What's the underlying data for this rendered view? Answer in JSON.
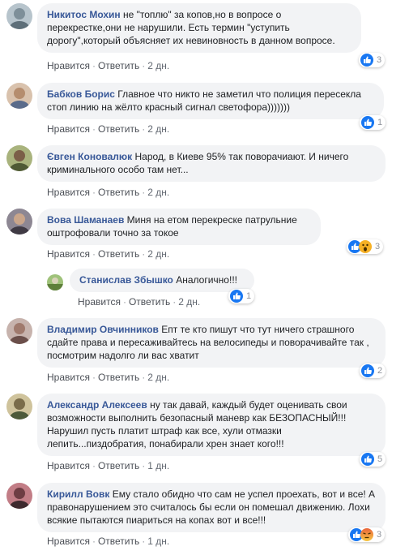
{
  "actions": {
    "like": "Нравится",
    "reply": "Ответить",
    "sep": "·"
  },
  "comments": [
    {
      "author": "Никитос Мохин",
      "text": "не \"топлю\" за копов,но в вопросе о перекрестке,они не нарушили. Есть термин \"уступить дорогу\",который объясняет их невиновность в данном вопросе.",
      "time": "2 дн.",
      "reactions": [
        "like-icon"
      ],
      "count": "3",
      "avatar_bg": "#8fa3b0"
    },
    {
      "author": "Бабков Борис",
      "text": "Главное что никто не заметил что полиция пересекла стоп линию на жёлто красный сигнал светофора)))))))",
      "time": "2 дн.",
      "reactions": [
        "like-icon"
      ],
      "count": "1",
      "avatar_bg": "#c7a88e"
    },
    {
      "author": "Євген Коновалюк",
      "text": "Народ, в Киеве 95% так поворачиают. И ничего криминального особо там нет...",
      "time": "2 дн.",
      "reactions": [],
      "count": "",
      "avatar_bg": "#7d8a5a"
    },
    {
      "author": "Вова Шаманаев",
      "text": "Миня на етом перекреске патрульние оштрофовали точно за токое",
      "time": "2 дн.",
      "reactions": [
        "like-icon",
        "wow-icon"
      ],
      "count": "3",
      "avatar_bg": "#6f6a73"
    },
    {
      "author": "Станислав Збышко",
      "text": "Аналогично!!!",
      "time": "2 дн.",
      "reactions": [
        "like-icon"
      ],
      "count": "1",
      "avatar_bg": "#6b8f4e"
    },
    {
      "author": "Владимир Овчинников",
      "text": "Епт те кто пишут что тут ничего страшного сдайте права и пересаживайтесь на велосипеды и поворачивайте так , посмотрим надолго ли вас хватит",
      "time": "2 дн.",
      "reactions": [
        "like-icon"
      ],
      "count": "2",
      "avatar_bg": "#9a7f7a"
    },
    {
      "author": "Александр Алексеев",
      "text": "ну так давай, каждый будет оценивать свои возможности выполнить безопасный маневр как БЕЗОПАСНЫЙ!!! Нарушил пусть платит штраф как все, хули отмазки лепить...пиздобратия, понабирали хрен знает кого!!!",
      "time": "1 дн.",
      "reactions": [
        "like-icon"
      ],
      "count": "5",
      "avatar_bg": "#a99a72"
    },
    {
      "author": "Кирилл Вовк",
      "text": "Ему стало обидно что сам не успел проехать, вот и все! А правонарушением это считалось бы если он помешал движению. Лохи всякие пытаются пиариться на копах вот и все!!!",
      "time": "1 дн.",
      "reactions": [
        "like-icon",
        "angry-icon"
      ],
      "count": "3",
      "avatar_bg": "#a35f68"
    }
  ]
}
